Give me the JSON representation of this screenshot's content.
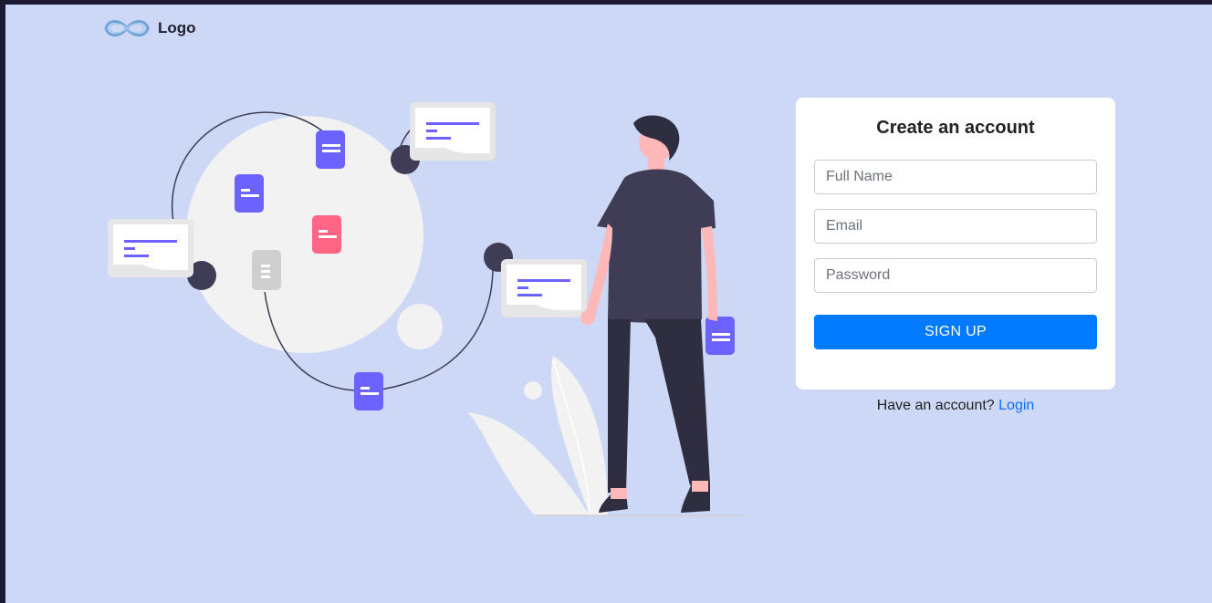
{
  "brand": {
    "logo_text": "Logo",
    "logo_icon": "infinity-icon"
  },
  "form": {
    "title": "Create an account",
    "full_name_placeholder": "Full Name",
    "email_placeholder": "Email",
    "password_placeholder": "Password",
    "submit_label": "SIGN UP"
  },
  "footer": {
    "prompt": "Have an account?",
    "login_link": "Login"
  },
  "colors": {
    "background": "#cdd7f6",
    "accent": "#007bff",
    "illustration_primary": "#6c63ff",
    "illustration_secondary": "#ff6584"
  }
}
